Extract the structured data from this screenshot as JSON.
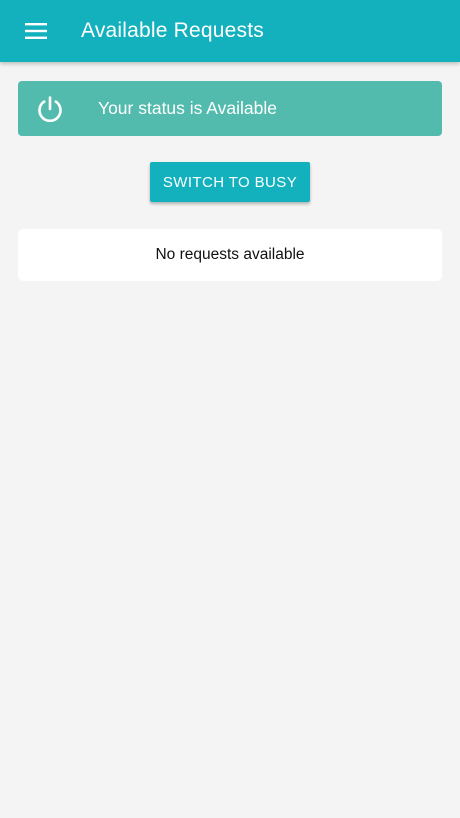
{
  "app_bar": {
    "title": "Available Requests",
    "menu_icon": "hamburger-menu-icon",
    "background_color": "#12b1bd"
  },
  "status": {
    "text": "Your status is Available",
    "icon": "power-icon",
    "background_color": "#52bbad"
  },
  "actions": {
    "switch_label": "SWITCH TO BUSY"
  },
  "requests": {
    "empty_message": "No requests available"
  }
}
